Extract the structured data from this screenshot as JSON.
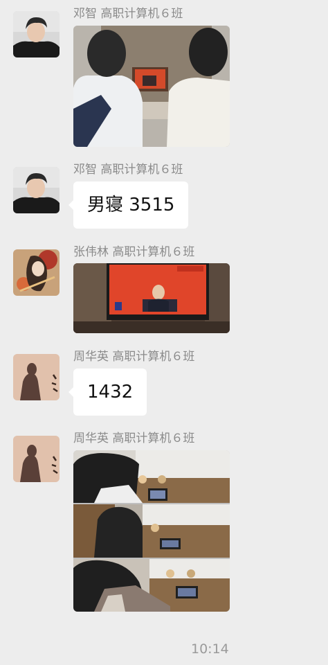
{
  "messages": [
    {
      "sender": "邓智 高职计算机６班",
      "type": "image",
      "image_desc": "two-students-watching-tv-photo"
    },
    {
      "sender": "邓智 高职计算机６班",
      "type": "text",
      "text": "男寝 3515"
    },
    {
      "sender": "张伟林 高职计算机６班",
      "type": "image",
      "image_desc": "tv-broadcast-photo"
    },
    {
      "sender": "周华英 高职计算机６班",
      "type": "text",
      "text": "1432"
    },
    {
      "sender": "周华英 高职计算机６班",
      "type": "image",
      "image_desc": "students-watching-phone-collage-photo"
    }
  ],
  "footer": {
    "time": "10:14"
  },
  "colors": {
    "background": "#ededed",
    "bubble": "#ffffff",
    "sender_text": "#8a8a8a",
    "time_text": "#9a9a9a"
  }
}
